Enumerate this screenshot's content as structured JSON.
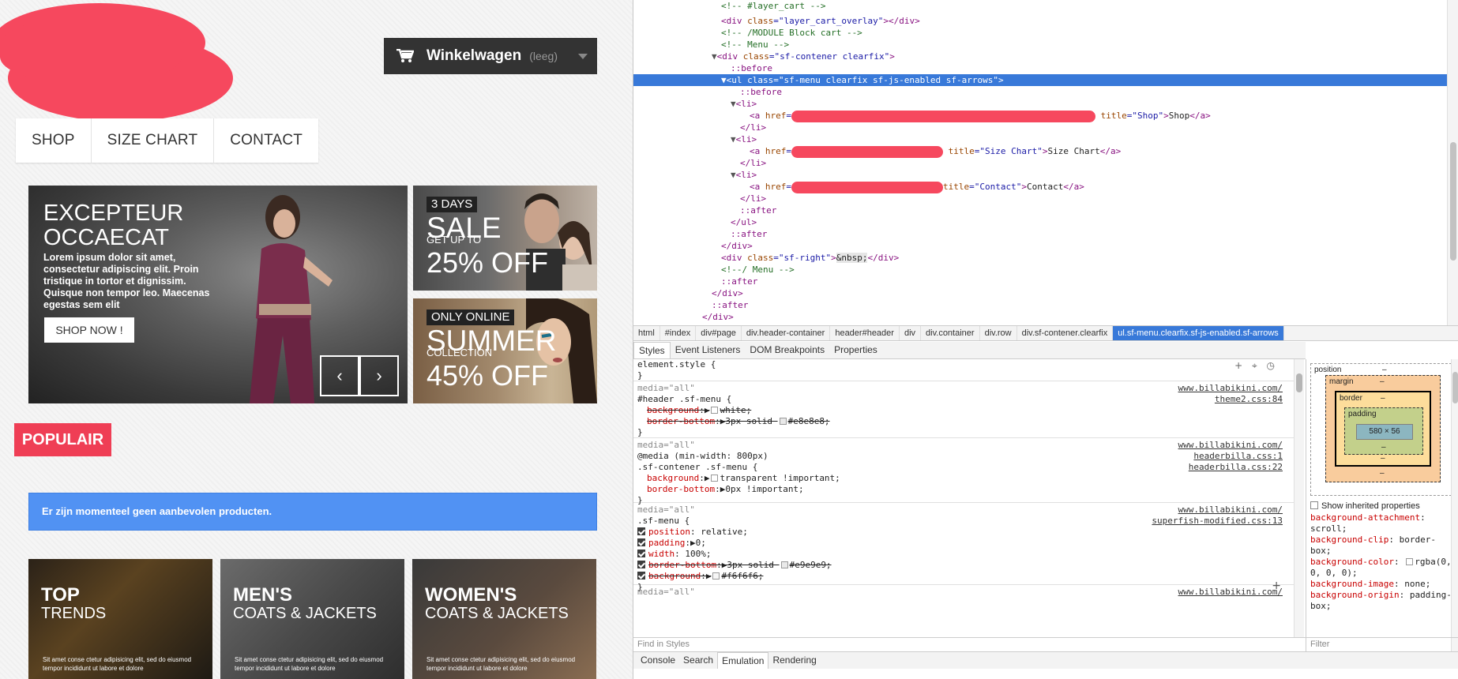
{
  "site": {
    "cart": {
      "title": "Winkelwagen",
      "status": "(leeg)"
    },
    "menu": [
      "SHOP",
      "SIZE CHART",
      "CONTACT"
    ],
    "slider": {
      "headline_1": "EXCEPTEUR",
      "headline_2": "OCCAECAT",
      "body": "Lorem ipsum dolor sit amet, consectetur adipiscing elit. Proin tristique in tortor et dignissim. Quisque non tempor leo. Maecenas egestas sem elit",
      "cta": "SHOP NOW !",
      "prev": "‹",
      "next": "›"
    },
    "promo_sale": {
      "tag": "3 DAYS",
      "big": "SALE",
      "small": "GET UP TO",
      "pct": "25% OFF"
    },
    "promo_summer": {
      "tag": "ONLY ONLINE",
      "big": "SUMMER",
      "small": "COLLECTION",
      "pct": "45% OFF"
    },
    "section_title": "POPULAIR",
    "alert": "Er zijn momenteel geen aanbevolen producten.",
    "tiles": [
      {
        "main": "TOP",
        "sub": "TRENDS",
        "body": "Sit amet conse ctetur adipisicing elit, sed do eiusmod tempor incididunt ut labore et dolore"
      },
      {
        "main": "MEN'S",
        "sub": "COATS & JACKETS",
        "body": "Sit amet conse ctetur adipisicing elit, sed do eiusmod tempor incididunt ut labore et dolore"
      },
      {
        "main": "WOMEN'S",
        "sub": "COATS & JACKETS",
        "body": "Sit amet conse ctetur adipisicing elit, sed do eiusmod tempor incididunt ut labore et dolore"
      }
    ]
  },
  "devtools": {
    "dom": {
      "l0": "<!-- #layer_cart -->",
      "l1a": "<div ",
      "l1b": "class",
      "l1c": "=\"layer_cart_overlay\"",
      "l1d": "></div>",
      "l2": "<!-- /MODULE Block cart -->",
      "l3": "<!-- Menu -->",
      "l4a": "<div ",
      "l4b": "class",
      "l4c": "=\"sf-contener clearfix\"",
      "l4d": ">",
      "l5": "::before",
      "l6": "<ul class=\"sf-menu clearfix sf-js-enabled sf-arrows\">",
      "l7": "::before",
      "l8": "<li>",
      "li_open": "<li>",
      "li_close": "</li>",
      "a_open": "<a ",
      "href": "href",
      "eq": "=",
      "title": "title",
      "a1_title": "=\"Shop\"",
      "a1_text": "Shop",
      "a2_title": "=\"Size Chart\"",
      "a2_text": "Size Chart",
      "a3_title": "=\"Contact\"",
      "a3_text": "Contact",
      "gt": ">",
      "a_close": "</a>",
      "after": "::after",
      "ul_close": "</ul>",
      "div_close": "</div>",
      "sfr_a": "<div ",
      "sfr_b": "class",
      "sfr_c": "=\"sf-right\"",
      "sfr_d": ">",
      "sfr_e": "&nbsp;",
      "sfr_f": "</div>",
      "menu_end": "<!--/ Menu -->"
    },
    "breadcrumb": [
      "html",
      "#index",
      "div#page",
      "div.header-container",
      "header#header",
      "div",
      "div.container",
      "div.row",
      "div.sf-contener.clearfix",
      "ul.sf-menu.clearfix.sf-js-enabled.sf-arrows"
    ],
    "subtabs": [
      "Styles",
      "Event Listeners",
      "DOM Breakpoints",
      "Properties"
    ],
    "styles": {
      "element_style": "element.style {",
      "close": "}",
      "media_all": "media=\"all\"",
      "src_site": "www.billabikini.com/",
      "r1_sel": "#header .sf-menu {",
      "r1_src": "theme2.css:84",
      "r1_p1": "background",
      "r1_v1": "white;",
      "r1_p2": "border-bottom",
      "r1_v2": "3px solid",
      "r1_v2b": "#e8e8e8;",
      "r2_media": "@media (min-width: 800px)",
      "r2_sel": ".sf-contener .sf-menu {",
      "r2_src1": "headerbilla.css:1",
      "r2_src2": "headerbilla.css:22",
      "r2_p1": "background",
      "r2_v1": "transparent !important;",
      "r2_p2": "border-bottom",
      "r2_v2": "0px !important;",
      "r3_sel": ".sf-menu {",
      "r3_src": "superfish-modified.css:13",
      "r3_p1": "position",
      "r3_v1": "relative;",
      "r3_p2": "padding",
      "r3_v2": "0;",
      "r3_p3": "width",
      "r3_v3": "100%;",
      "r3_p4": "border-bottom",
      "r3_v4": "3px solid",
      "r3_v4b": "#e9e9e9;",
      "r3_p5": "background",
      "r3_v5": "#f6f6f6;",
      "find": "Find in Styles"
    },
    "box_model": {
      "position": "position",
      "margin": "margin",
      "border": "border",
      "padding": "padding",
      "dash": "–",
      "content": "580 × 56"
    },
    "computed": {
      "show_inherited": "Show inherited properties",
      "lines": [
        {
          "p": "background-attachment",
          "v": "scroll;"
        },
        {
          "p": "background-clip",
          "v": "border-box;"
        },
        {
          "p": "background-color",
          "v": "rgba(0, 0, 0, 0);"
        },
        {
          "p": "background-image",
          "v": "none;"
        },
        {
          "p": "background-origin",
          "v": "padding-box;"
        }
      ],
      "filter": "Filter"
    },
    "drawer_tabs": [
      "Console",
      "Search",
      "Emulation",
      "Rendering"
    ]
  }
}
